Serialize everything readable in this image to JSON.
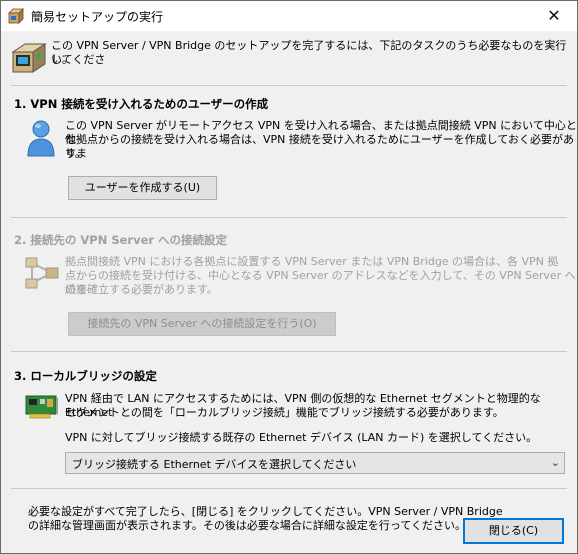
{
  "window": {
    "title": "簡易セットアップの実行",
    "close_glyph": "✕"
  },
  "intro": {
    "text_line1": "この VPN Server / VPN Bridge のセットアップを完了するには、下記のタスクのうち必要なものを実行してくださ",
    "text_line2": "い。"
  },
  "section1": {
    "heading": "1. VPN 接続を受け入れるためのユーザーの作成",
    "desc_line1": "この VPN Server がリモートアクセス VPN を受け入れる場合、または拠点間接続 VPN において中心とな",
    "desc_line2": "他拠点からの接続を受け入れる場合は、VPN 接続を受け入れるためにユーザーを作成しておく必要がありま",
    "desc_line3": "す。",
    "button": "ユーザーを作成する(U)"
  },
  "section2": {
    "heading": "2. 接続先の VPN Server への接続設定",
    "desc_line1": "拠点間接続 VPN における各拠点に設置する VPN Server または VPN Bridge の場合は、各 VPN 拠",
    "desc_line2": "点からの接続を受け付ける、中心となる VPN Server のアドレスなどを入力して、その VPN Server への接",
    "desc_line3": "続を確立する必要があります。",
    "button": "接続先の VPN Server への接続設定を行う(O)"
  },
  "section3": {
    "heading": "3. ローカルブリッジの設定",
    "desc_line1": "VPN 経由で LAN にアクセスするためには、VPN 側の仮想的な Ethernet セグメントと物理的な Ethernet",
    "desc_line2": "セグメントとの間を「ローカルブリッジ接続」機能でブリッジ接続する必要があります。",
    "select_prompt": "VPN に対してブリッジ接続する既存の Ethernet デバイス (LAN カード) を選択してください。",
    "select_value": "ブリッジ接続する Ethernet デバイスを選択してください",
    "chevron": "⌄"
  },
  "footer": {
    "text_line1": "必要な設定がすべて完了したら、[閉じる] をクリックしてください。VPN Server / VPN Bridge",
    "text_line2": "の詳細な管理画面が表示されます。その後は必要な場合に詳細な設定を行ってください。",
    "close_button": "閉じる(C)"
  },
  "icons": {
    "title": "setup-box-icon",
    "intro": "vpn-server-box-icon",
    "user": "user-icon",
    "network": "network-nodes-icon",
    "lan_card": "network-card-icon"
  },
  "colors": {
    "accent": "#0078d7",
    "disabled_text": "#a0a0a0"
  }
}
